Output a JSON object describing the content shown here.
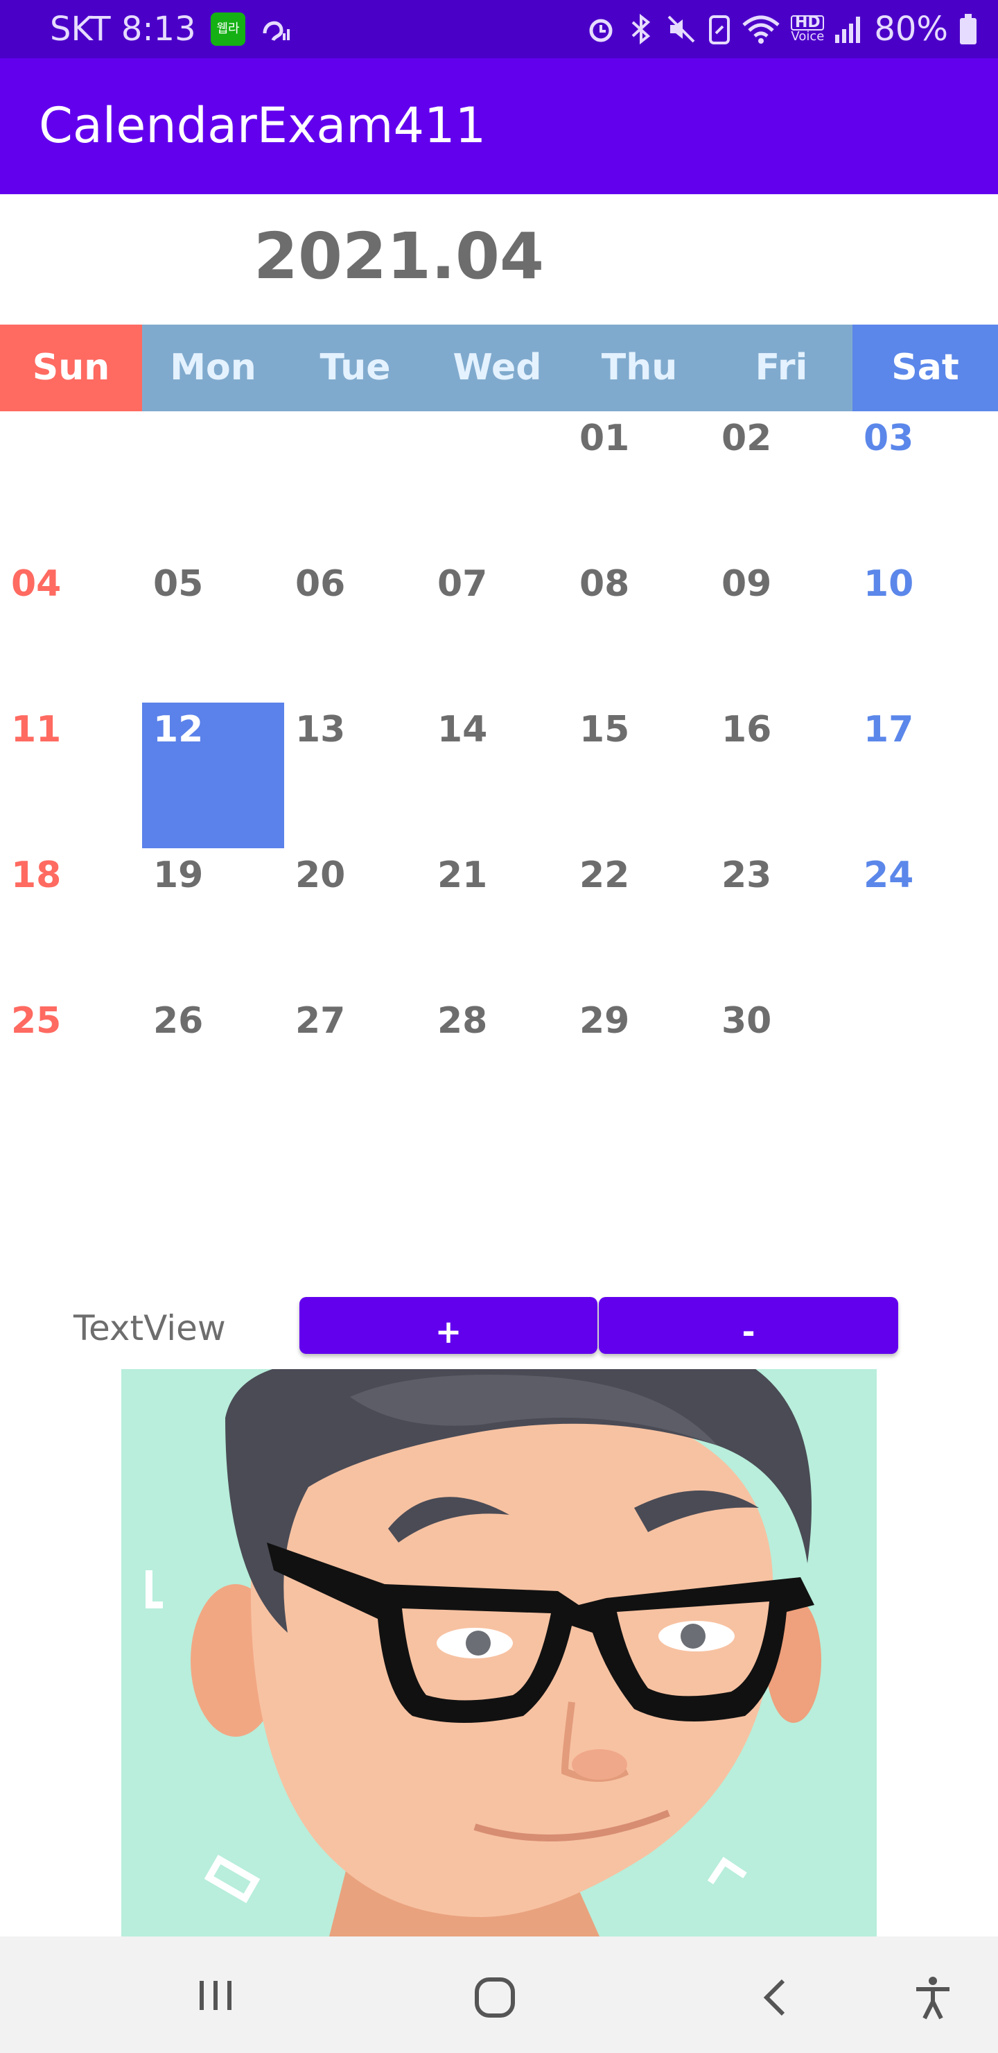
{
  "status_bar": {
    "carrier": "SKT",
    "time": "8:13",
    "carrier_badge": "웹라",
    "battery_percent": "80%",
    "hd_label": "HD",
    "voice_label": "Voice",
    "icons": [
      "hearing-icon",
      "alarm-icon",
      "bluetooth-icon",
      "mute-icon",
      "battery-saver-icon",
      "wifi-icon",
      "hd-voice-icon",
      "signal-icon",
      "battery-icon"
    ]
  },
  "app_bar": {
    "title": "CalendarExam411"
  },
  "calendar": {
    "month_label": "2021.04",
    "weekdays": [
      "Sun",
      "Mon",
      "Tue",
      "Wed",
      "Thu",
      "Fri",
      "Sat"
    ],
    "weeks": [
      [
        "",
        "",
        "",
        "",
        "01",
        "02",
        "03"
      ],
      [
        "04",
        "05",
        "06",
        "07",
        "08",
        "09",
        "10"
      ],
      [
        "11",
        "12",
        "13",
        "14",
        "15",
        "16",
        "17"
      ],
      [
        "18",
        "19",
        "20",
        "21",
        "22",
        "23",
        "24"
      ],
      [
        "25",
        "26",
        "27",
        "28",
        "29",
        "30",
        ""
      ]
    ],
    "selected_day": "12",
    "colors": {
      "sunday": "#ff6a61",
      "saturday": "#5b87ea",
      "weekday": "#6d6d6d",
      "selected_bg": "#5b82ea"
    }
  },
  "controls": {
    "textview": "TextView",
    "plus_label": "+",
    "minus_label": "-"
  },
  "image": {
    "icon": "avatar-image"
  },
  "nav_bar": {
    "icons": [
      "recent-apps-icon",
      "home-icon",
      "back-icon",
      "accessibility-icon"
    ]
  }
}
